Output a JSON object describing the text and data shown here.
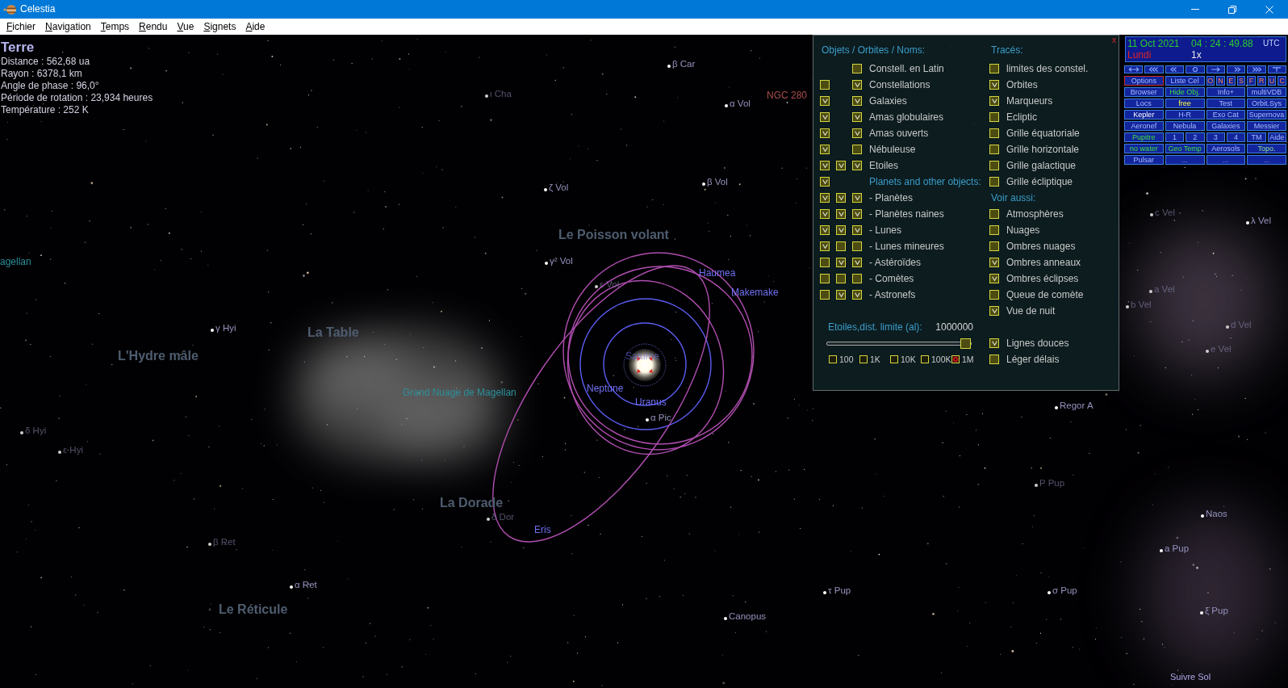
{
  "window": {
    "title": "Celestia"
  },
  "menu": [
    "Fichier",
    "Navigation",
    "Temps",
    "Rendu",
    "Vue",
    "Signets",
    "Aide"
  ],
  "info": {
    "name": "Terre",
    "lines": [
      "Distance : 562,68 ua",
      "Rayon : 6378,1 km",
      "Angle de phase : 96,0°",
      "Période de rotation : 23,934 heures",
      "Température : 252 K"
    ]
  },
  "sky_labels": [
    {
      "kind": "star",
      "text": "β Car",
      "faint": false
    },
    {
      "kind": "star",
      "text": "ι Cha",
      "faint": true
    },
    {
      "kind": "star",
      "text": "α Vol",
      "faint": false
    },
    {
      "kind": "nebula",
      "text": "NGC 280",
      "faint": false
    },
    {
      "kind": "star",
      "text": "ζ Vol",
      "faint": false
    },
    {
      "kind": "star",
      "text": "β Vol",
      "faint": false
    },
    {
      "kind": "constellation",
      "text": "Le Poisson volant",
      "faint": false
    },
    {
      "kind": "star",
      "text": "γ² Vol",
      "faint": false
    },
    {
      "kind": "star",
      "text": "ε Vol",
      "faint": true
    },
    {
      "kind": "planet",
      "text": "Haumea",
      "faint": false
    },
    {
      "kind": "planet",
      "text": "Makemake",
      "faint": false
    },
    {
      "kind": "galaxy",
      "text": "agellan",
      "faint": false
    },
    {
      "kind": "star",
      "text": "γ Hyi",
      "faint": false
    },
    {
      "kind": "constellation",
      "text": "La Table",
      "faint": false
    },
    {
      "kind": "constellation",
      "text": "L'Hydre mâle",
      "faint": false
    },
    {
      "kind": "galaxy",
      "text": "Grand Nuage de Magellan",
      "faint": false
    },
    {
      "kind": "planet",
      "text": "Saturne",
      "faint": true
    },
    {
      "kind": "planet",
      "text": "Neptune",
      "faint": false
    },
    {
      "kind": "planet",
      "text": "Uranus",
      "faint": false
    },
    {
      "kind": "star",
      "text": "α Pic",
      "faint": false
    },
    {
      "kind": "star",
      "text": "δ Hyi",
      "faint": true
    },
    {
      "kind": "star",
      "text": "ε Hyi",
      "faint": true
    },
    {
      "kind": "constellation",
      "text": "La Dorade",
      "faint": false
    },
    {
      "kind": "star",
      "text": "δ Dor",
      "faint": true
    },
    {
      "kind": "planet",
      "text": "Eris",
      "faint": false
    },
    {
      "kind": "star",
      "text": "β Ret",
      "faint": true
    },
    {
      "kind": "star",
      "text": "α Ret",
      "faint": false
    },
    {
      "kind": "constellation",
      "text": "Le Réticule",
      "faint": false
    },
    {
      "kind": "star",
      "text": "Canopus",
      "faint": false
    },
    {
      "kind": "star",
      "text": "τ Pup",
      "faint": false
    },
    {
      "kind": "star",
      "text": "σ Pup",
      "faint": false
    },
    {
      "kind": "star",
      "text": "ξ Pup",
      "faint": false
    },
    {
      "kind": "star",
      "text": "a Pup",
      "faint": false
    },
    {
      "kind": "star",
      "text": "Naos",
      "faint": false
    },
    {
      "kind": "star",
      "text": "P Pup",
      "faint": true
    },
    {
      "kind": "star",
      "text": "Regor A",
      "faint": false
    },
    {
      "kind": "star",
      "text": "c Vel",
      "faint": true
    },
    {
      "kind": "star",
      "text": "λ Vel",
      "faint": false
    },
    {
      "kind": "star",
      "text": "a Vel",
      "faint": true
    },
    {
      "kind": "star",
      "text": "b Vel",
      "faint": true
    },
    {
      "kind": "star",
      "text": "d Vel",
      "faint": true
    },
    {
      "kind": "star",
      "text": "e Vel",
      "faint": true
    }
  ],
  "status": {
    "follow": "Suivre Sol"
  },
  "options_panel": {
    "close": "x",
    "left_heading": "Objets / Orbites / Noms:",
    "left_rows": [
      {
        "kind": "item",
        "label": "Constell. en Latin",
        "name_checked": false
      },
      {
        "kind": "item",
        "label": "Constellations",
        "object_checked": false,
        "name_checked": true
      },
      {
        "kind": "item",
        "label": "Galaxies",
        "object_checked": true,
        "name_checked": true
      },
      {
        "kind": "item",
        "label": "Amas globulaires",
        "object_checked": true,
        "name_checked": true
      },
      {
        "kind": "item",
        "label": "Amas ouverts",
        "object_checked": true,
        "name_checked": true
      },
      {
        "kind": "item",
        "label": "Nébuleuse",
        "object_checked": true,
        "name_checked": false
      },
      {
        "kind": "item",
        "label": "Etoiles",
        "object_checked": true,
        "orbit_checked": true,
        "name_checked": true
      },
      {
        "kind": "heading",
        "label": "Planets and other objects:",
        "object_checked": true
      },
      {
        "kind": "item",
        "label": "- Planètes",
        "object_checked": true,
        "orbit_checked": true,
        "name_checked": true
      },
      {
        "kind": "item",
        "label": "- Planètes naines",
        "object_checked": true,
        "orbit_checked": true,
        "name_checked": true
      },
      {
        "kind": "item",
        "label": "- Lunes",
        "object_checked": true,
        "orbit_checked": true,
        "name_checked": true
      },
      {
        "kind": "item",
        "label": "- Lunes mineures",
        "object_checked": true,
        "orbit_checked": false,
        "name_checked": false
      },
      {
        "kind": "item",
        "label": "- Astéroïdes",
        "object_checked": false,
        "orbit_checked": true,
        "name_checked": true
      },
      {
        "kind": "item",
        "label": "- Comètes",
        "object_checked": false,
        "orbit_checked": false,
        "name_checked": false
      },
      {
        "kind": "item",
        "label": "- Astronefs",
        "object_checked": false,
        "orbit_checked": true,
        "name_checked": true
      }
    ],
    "right_groups": [
      {
        "heading": "Tracés:",
        "items": [
          {
            "label": "limites des constel.",
            "checked": false
          },
          {
            "label": "Orbites",
            "checked": true
          },
          {
            "label": "Marqueurs",
            "checked": true
          },
          {
            "label": "Ecliptic",
            "checked": false
          },
          {
            "label": "Grille équatoriale",
            "checked": false
          },
          {
            "label": "Grille horizontale",
            "checked": false
          },
          {
            "label": "Grille galactique",
            "checked": false
          },
          {
            "label": "Grille écliptique",
            "checked": false
          }
        ]
      },
      {
        "heading": "Voir aussi:",
        "items": [
          {
            "label": "Atmosphères",
            "checked": false
          },
          {
            "label": "Nuages",
            "checked": false
          },
          {
            "label": "Ombres nuages",
            "checked": false
          },
          {
            "label": "Ombres anneaux",
            "checked": true
          },
          {
            "label": "Ombres éclipses",
            "checked": true
          },
          {
            "label": "Queue de comète",
            "checked": false
          },
          {
            "label": "Vue de nuit",
            "checked": true
          }
        ]
      },
      {
        "items": [
          {
            "label": "Lignes douces",
            "checked": true
          },
          {
            "label": "Léger délais",
            "checked": false
          }
        ]
      }
    ],
    "distance_label": "Etoiles,dist. limite (al):",
    "distance_value": "1000000",
    "distance_slider": {
      "level": 1.0
    },
    "distance_presets": [
      {
        "label": "100",
        "selected": false
      },
      {
        "label": "1K",
        "selected": false
      },
      {
        "label": "10K",
        "selected": false
      },
      {
        "label": "100K",
        "selected": false
      },
      {
        "label": "1M",
        "selected": true
      }
    ]
  },
  "time_panel": {
    "date": "11 Oct 2021",
    "time": "04 : 24 : 49.88",
    "zone": "UTC",
    "weekday": "Lundi",
    "rate": "1x"
  },
  "button_grid": [
    [
      [
        {
          "label": "Options",
          "kind": "default",
          "selected": true
        }
      ],
      [
        {
          "label": "Liste Cel",
          "kind": "default",
          "selected": false
        }
      ],
      [
        {
          "label": "O",
          "kind": "letter",
          "selected": false
        },
        {
          "label": "N",
          "kind": "letter",
          "selected": false
        },
        {
          "label": "E",
          "kind": "letter",
          "selected": false
        },
        {
          "label": "S",
          "kind": "letter",
          "selected": false
        }
      ],
      [
        {
          "label": "F",
          "kind": "letter",
          "selected": false
        },
        {
          "label": "R",
          "kind": "letter",
          "selected": false
        },
        {
          "label": "U",
          "kind": "letter",
          "selected": false
        },
        {
          "label": "C",
          "kind": "letter",
          "selected": false
        }
      ]
    ],
    [
      [
        {
          "label": "Browser",
          "kind": "default",
          "selected": false
        }
      ],
      [
        {
          "label": "Hide Obj.",
          "kind": "toggle",
          "selected": false
        }
      ],
      [
        {
          "label": "Info+",
          "kind": "default",
          "selected": false
        }
      ],
      [
        {
          "label": "multiVDB",
          "kind": "default",
          "selected": false
        }
      ]
    ],
    [
      [
        {
          "label": "Locs",
          "kind": "default",
          "selected": false
        }
      ],
      [
        {
          "label": "free",
          "kind": "highlight",
          "selected": false
        }
      ],
      [
        {
          "label": "Test",
          "kind": "default",
          "selected": false
        }
      ],
      [
        {
          "label": "Orbit.Sys",
          "kind": "default",
          "selected": false
        }
      ]
    ],
    [
      [
        {
          "label": "Kepler",
          "kind": "bright",
          "selected": false
        }
      ],
      [
        {
          "label": "H-R",
          "kind": "default",
          "selected": false
        }
      ],
      [
        {
          "label": "Exo Cat",
          "kind": "default",
          "selected": false
        }
      ],
      [
        {
          "label": "Supernova",
          "kind": "default",
          "selected": false
        }
      ]
    ],
    [
      [
        {
          "label": "Aeronef",
          "kind": "default",
          "selected": false
        }
      ],
      [
        {
          "label": "Nebula",
          "kind": "default",
          "selected": false
        }
      ],
      [
        {
          "label": "Galaxies",
          "kind": "default",
          "selected": false
        }
      ],
      [
        {
          "label": "Messier",
          "kind": "default",
          "selected": false
        }
      ]
    ],
    [
      [
        {
          "label": "Pupitre",
          "kind": "toggle",
          "selected": false
        }
      ],
      [
        {
          "label": "1",
          "kind": "default",
          "selected": false
        },
        {
          "label": "2",
          "kind": "default",
          "selected": false
        }
      ],
      [
        {
          "label": "3",
          "kind": "default",
          "selected": false
        },
        {
          "label": "4",
          "kind": "default",
          "selected": false
        }
      ],
      [
        {
          "label": "TM",
          "kind": "default",
          "selected": false
        },
        {
          "label": "Aide",
          "kind": "default",
          "selected": false
        }
      ]
    ],
    [
      [
        {
          "label": "no water",
          "kind": "toggle",
          "selected": false
        }
      ],
      [
        {
          "label": "Geo Temp",
          "kind": "toggle",
          "selected": false
        }
      ],
      [
        {
          "label": "Aerosols",
          "kind": "default",
          "selected": false
        }
      ],
      [
        {
          "label": "Topo.",
          "kind": "soft_toggle",
          "selected": false
        }
      ]
    ],
    [
      [
        {
          "label": "Pulsar",
          "kind": "default",
          "selected": false
        }
      ],
      [
        {
          "label": "...",
          "kind": "blank",
          "selected": false
        }
      ],
      [
        {
          "label": "...",
          "kind": "blank",
          "selected": false
        }
      ],
      [
        {
          "label": "...",
          "kind": "blank",
          "selected": false
        }
      ]
    ]
  ]
}
